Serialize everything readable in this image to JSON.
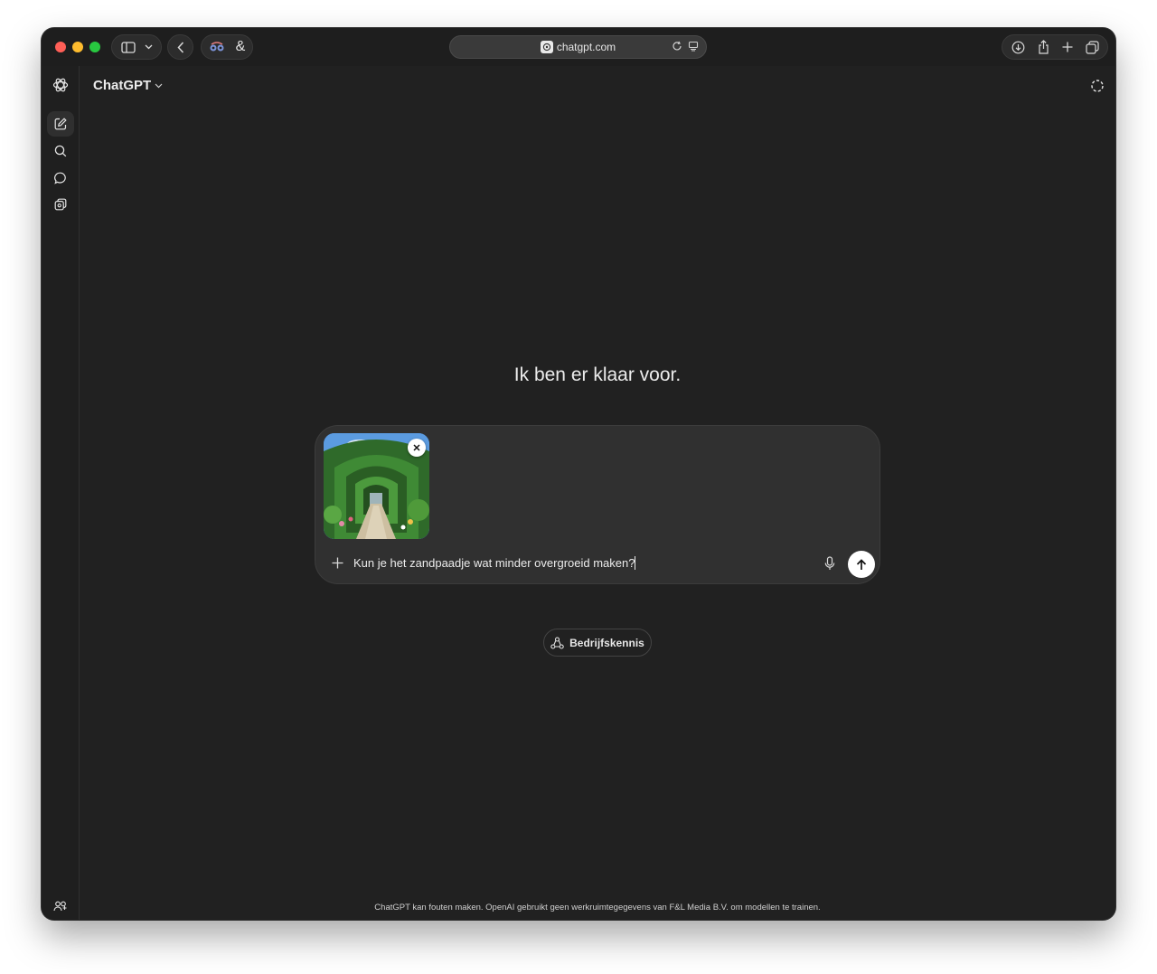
{
  "browser": {
    "url": "chatgpt.com",
    "extension_label": "&"
  },
  "app": {
    "title": "ChatGPT"
  },
  "sidebar": {
    "items": [
      {
        "icon": "new-chat-icon"
      },
      {
        "icon": "search-icon"
      },
      {
        "icon": "chat-bubble-icon"
      },
      {
        "icon": "library-icon"
      }
    ],
    "bottom": [
      {
        "icon": "team-icon"
      },
      {
        "icon": "upgrade-badge-icon"
      }
    ]
  },
  "main": {
    "headline": "Ik ben er klaar voor.",
    "composer": {
      "attachment": "image-thumbnail",
      "text": "Kun je het zandpaadje wat minder overgroeid maken?"
    },
    "chip_label": "Bedrijfskennis",
    "disclaimer": "ChatGPT kan fouten maken. OpenAI gebruikt geen werkruimtegegevens van F&L Media B.V. om modellen te trainen."
  },
  "colors": {
    "background": "#212121",
    "composer": "#303030",
    "text": "#ececec",
    "accent_badge": "#4d5cf0"
  }
}
